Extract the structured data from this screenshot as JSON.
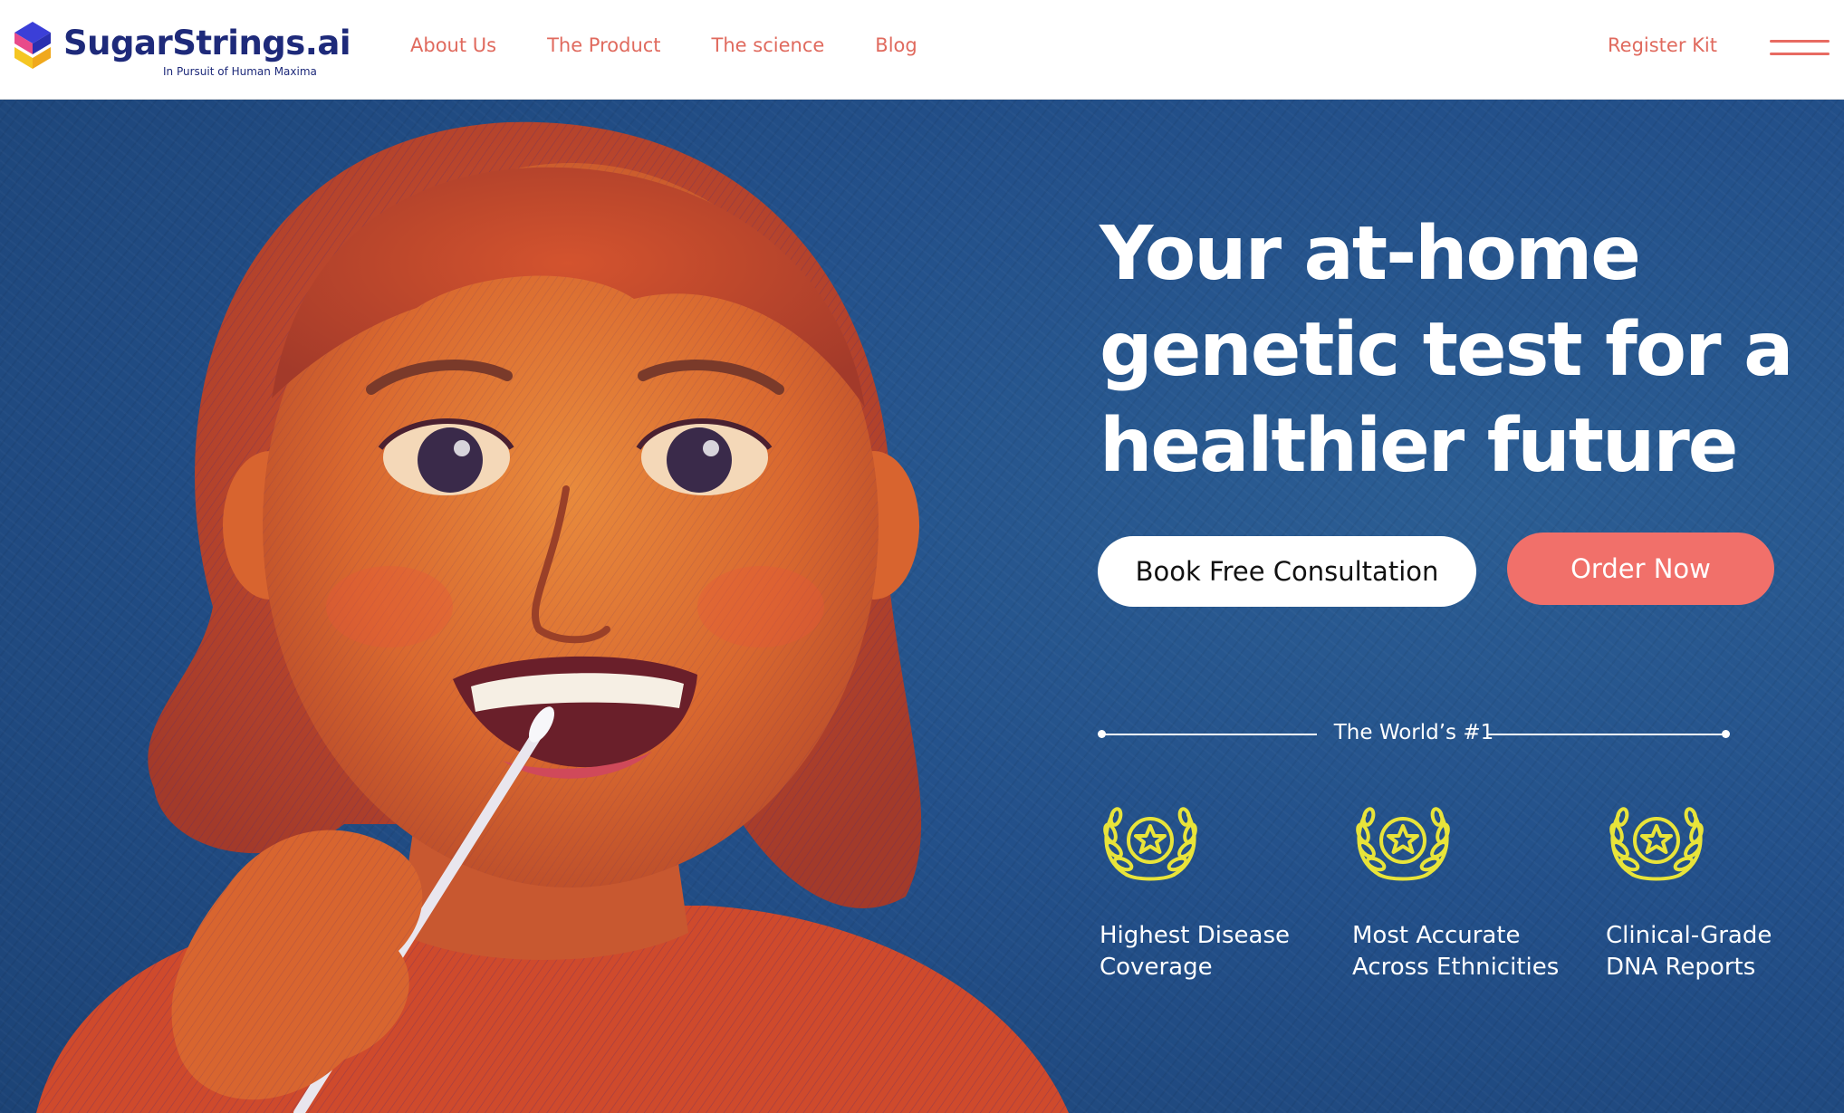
{
  "header": {
    "logo": {
      "name": "SugarStrings.ai",
      "tagline": "In Pursuit of Human Maxima"
    },
    "nav": [
      {
        "label": "About Us"
      },
      {
        "label": "The Product"
      },
      {
        "label": "The science"
      },
      {
        "label": "Blog"
      }
    ],
    "register_kit": "Register Kit",
    "menu_icon": "hamburger-menu-icon"
  },
  "hero": {
    "headline": "Your at-home genetic test for a healthier future",
    "buttons": {
      "consult": "Book Free Consultation",
      "order": "Order Now"
    },
    "worlds_number": "The World’s #1",
    "awards": [
      {
        "icon": "laurel-star-icon",
        "label": "Highest Disease\nCoverage"
      },
      {
        "icon": "laurel-star-icon",
        "label": "Most Accurate\nAcross Ethnicities"
      },
      {
        "icon": "laurel-star-icon",
        "label": "Clinical-Grade\nDNA Reports"
      }
    ]
  },
  "colors": {
    "brand_navy": "#1e2a7a",
    "nav_coral": "#e06a5e",
    "order_button": "#f1706a",
    "hero_blue": "#23508a",
    "award_yellow": "#e8e43a"
  }
}
